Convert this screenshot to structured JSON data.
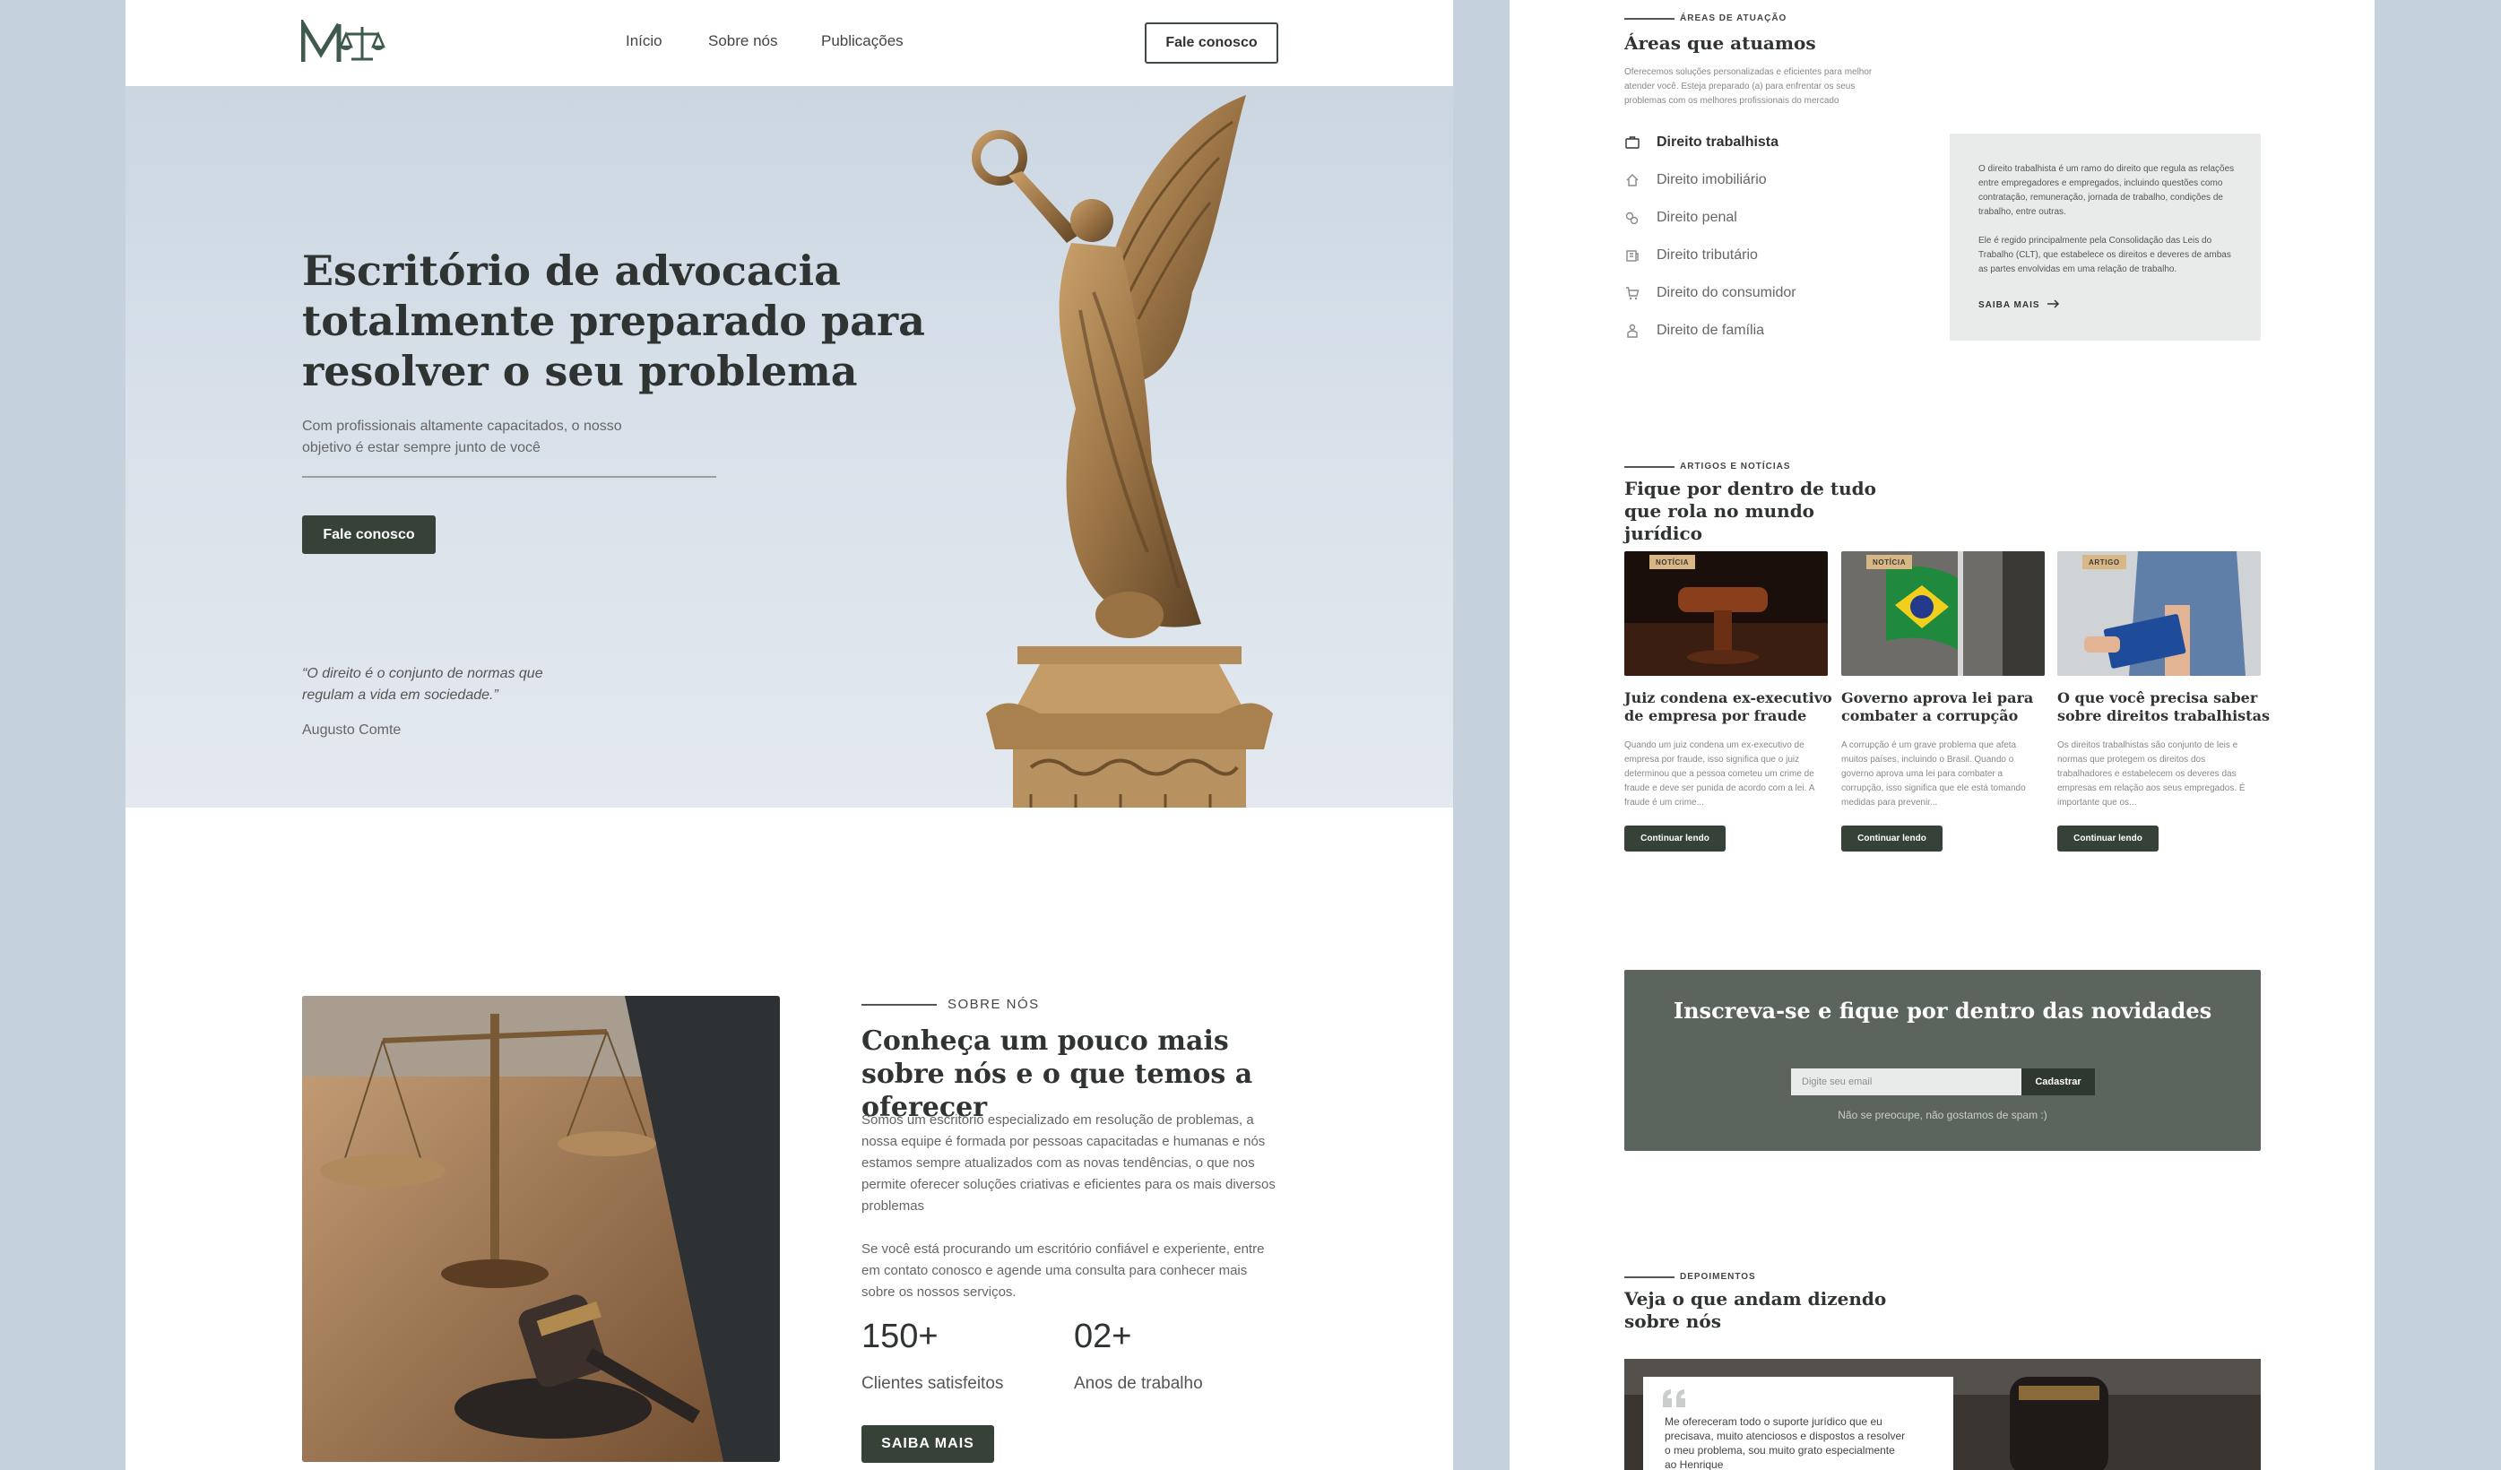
{
  "colors": {
    "page_bg": "#c5d2de",
    "accent_dark": "#364238",
    "tag": "#d9b785",
    "newsletter_bg": "#5b655d"
  },
  "nav": {
    "logo_icon": "scales-logo-icon",
    "links": [
      "Início",
      "Sobre nós",
      "Publicações"
    ],
    "cta": "Fale conosco"
  },
  "hero": {
    "title": "Escritório de advocacia totalmente preparado para resolver o seu problema",
    "subtitle": "Com profissionais altamente capacitados, o nosso objetivo é estar sempre junto de você",
    "cta": "Fale conosco",
    "quote": "“O direito é o conjunto de normas que regulam a vida em sociedade.”",
    "quote_author": "Augusto Comte"
  },
  "about": {
    "eyebrow": "SOBRE NÓS",
    "title": "Conheça um pouco mais sobre nós e o que temos a oferecer",
    "p1": "Somos um escritório especializado em resolução de problemas, a nossa equipe é formada por pessoas capacitadas e humanas e nós estamos sempre atualizados com as novas tendências, o que nos permite oferecer soluções criativas e eficientes para os mais diversos problemas",
    "p2": "Se você está procurando um escritório confiável e experiente, entre em contato conosco e agende uma consulta para conhecer mais sobre os nossos serviços.",
    "stats": [
      {
        "value": "150+",
        "label": "Clientes satisfeitos"
      },
      {
        "value": "02+",
        "label": "Anos de trabalho"
      }
    ],
    "cta": "SAIBA MAIS"
  },
  "areas": {
    "eyebrow": "ÁREAS DE ATUAÇÃO",
    "title": "Áreas que atuamos",
    "desc": "Oferecemos soluções personalizadas e eficientes para melhor atender você. Esteja preparado (a) para enfrentar os seus problemas com os melhores profissionais do mercado",
    "items": [
      {
        "label": "Direito trabalhista",
        "icon": "briefcase-icon"
      },
      {
        "label": "Direito imobiliário",
        "icon": "house-icon"
      },
      {
        "label": "Direito penal",
        "icon": "handcuffs-icon"
      },
      {
        "label": "Direito tributário",
        "icon": "money-icon"
      },
      {
        "label": "Direito do consumidor",
        "icon": "cart-icon"
      },
      {
        "label": "Direito de família",
        "icon": "family-icon"
      }
    ],
    "card": {
      "p1": "O direito trabalhista é um ramo do direito que regula as relações entre empregadores e empregados, incluindo questões como contratação, remuneração, jornada de trabalho, condições de trabalho, entre outras.",
      "p2": "Ele é regido principalmente pela Consolidação das Leis do Trabalho (CLT), que estabelece os direitos e deveres de ambas as partes envolvidas em uma relação de trabalho.",
      "more": "SAIBA MAIS"
    }
  },
  "news": {
    "eyebrow": "ARTIGOS E NOTÍCIAS",
    "title": "Fique por dentro de tudo que rola no mundo jurídico",
    "items": [
      {
        "tag": "NOTÍCIA",
        "title": "Juiz condena ex-executivo de empresa por fraude",
        "excerpt": "Quando um juiz condena um ex-executivo de empresa por fraude, isso significa que o juiz determinou que a pessoa cometeu um crime de fraude e deve ser punida de acordo com a lei. A fraude é um crime...",
        "button": "Continuar lendo"
      },
      {
        "tag": "NOTÍCIA",
        "title": "Governo aprova lei para combater a corrupção",
        "excerpt": "A corrupção é um grave problema que afeta muitos países, incluindo o Brasil. Quando o governo aprova uma lei para combater a corrupção, isso significa que ele está tomando medidas para prevenir...",
        "button": "Continuar lendo"
      },
      {
        "tag": "ARTIGO",
        "title": "O que você precisa saber sobre direitos trabalhistas",
        "excerpt": "Os direitos trabalhistas são conjunto de leis e normas que protegem os direitos dos trabalhadores e estabelecem os deveres das empresas em relação aos seus empregados. É importante que os...",
        "button": "Continuar lendo"
      }
    ]
  },
  "newsletter": {
    "title": "Inscreva-se e fique por dentro das novidades",
    "placeholder": "Digite seu email",
    "button": "Cadastrar",
    "note": "Não se preocupe, não gostamos de spam :)"
  },
  "testimonials": {
    "eyebrow": "DEPOIMENTOS",
    "title": "Veja o que andam dizendo sobre nós",
    "quote_icon": "quote-mark-icon",
    "text": "Me ofereceram todo o suporte jurídico que eu precisava, muito atenciosos e dispostos a resolver o meu problema, sou muito grato especialmente ao Henrique"
  }
}
